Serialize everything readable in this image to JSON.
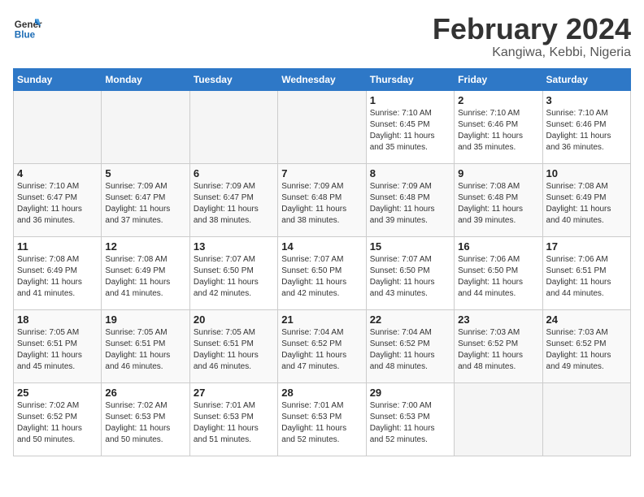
{
  "logo": {
    "line1": "General",
    "line2": "Blue"
  },
  "title": "February 2024",
  "subtitle": "Kangiwa, Kebbi, Nigeria",
  "days_of_week": [
    "Sunday",
    "Monday",
    "Tuesday",
    "Wednesday",
    "Thursday",
    "Friday",
    "Saturday"
  ],
  "weeks": [
    [
      {
        "day": "",
        "info": ""
      },
      {
        "day": "",
        "info": ""
      },
      {
        "day": "",
        "info": ""
      },
      {
        "day": "",
        "info": ""
      },
      {
        "day": "1",
        "info": "Sunrise: 7:10 AM\nSunset: 6:45 PM\nDaylight: 11 hours\nand 35 minutes."
      },
      {
        "day": "2",
        "info": "Sunrise: 7:10 AM\nSunset: 6:46 PM\nDaylight: 11 hours\nand 35 minutes."
      },
      {
        "day": "3",
        "info": "Sunrise: 7:10 AM\nSunset: 6:46 PM\nDaylight: 11 hours\nand 36 minutes."
      }
    ],
    [
      {
        "day": "4",
        "info": "Sunrise: 7:10 AM\nSunset: 6:47 PM\nDaylight: 11 hours\nand 36 minutes."
      },
      {
        "day": "5",
        "info": "Sunrise: 7:09 AM\nSunset: 6:47 PM\nDaylight: 11 hours\nand 37 minutes."
      },
      {
        "day": "6",
        "info": "Sunrise: 7:09 AM\nSunset: 6:47 PM\nDaylight: 11 hours\nand 38 minutes."
      },
      {
        "day": "7",
        "info": "Sunrise: 7:09 AM\nSunset: 6:48 PM\nDaylight: 11 hours\nand 38 minutes."
      },
      {
        "day": "8",
        "info": "Sunrise: 7:09 AM\nSunset: 6:48 PM\nDaylight: 11 hours\nand 39 minutes."
      },
      {
        "day": "9",
        "info": "Sunrise: 7:08 AM\nSunset: 6:48 PM\nDaylight: 11 hours\nand 39 minutes."
      },
      {
        "day": "10",
        "info": "Sunrise: 7:08 AM\nSunset: 6:49 PM\nDaylight: 11 hours\nand 40 minutes."
      }
    ],
    [
      {
        "day": "11",
        "info": "Sunrise: 7:08 AM\nSunset: 6:49 PM\nDaylight: 11 hours\nand 41 minutes."
      },
      {
        "day": "12",
        "info": "Sunrise: 7:08 AM\nSunset: 6:49 PM\nDaylight: 11 hours\nand 41 minutes."
      },
      {
        "day": "13",
        "info": "Sunrise: 7:07 AM\nSunset: 6:50 PM\nDaylight: 11 hours\nand 42 minutes."
      },
      {
        "day": "14",
        "info": "Sunrise: 7:07 AM\nSunset: 6:50 PM\nDaylight: 11 hours\nand 42 minutes."
      },
      {
        "day": "15",
        "info": "Sunrise: 7:07 AM\nSunset: 6:50 PM\nDaylight: 11 hours\nand 43 minutes."
      },
      {
        "day": "16",
        "info": "Sunrise: 7:06 AM\nSunset: 6:50 PM\nDaylight: 11 hours\nand 44 minutes."
      },
      {
        "day": "17",
        "info": "Sunrise: 7:06 AM\nSunset: 6:51 PM\nDaylight: 11 hours\nand 44 minutes."
      }
    ],
    [
      {
        "day": "18",
        "info": "Sunrise: 7:05 AM\nSunset: 6:51 PM\nDaylight: 11 hours\nand 45 minutes."
      },
      {
        "day": "19",
        "info": "Sunrise: 7:05 AM\nSunset: 6:51 PM\nDaylight: 11 hours\nand 46 minutes."
      },
      {
        "day": "20",
        "info": "Sunrise: 7:05 AM\nSunset: 6:51 PM\nDaylight: 11 hours\nand 46 minutes."
      },
      {
        "day": "21",
        "info": "Sunrise: 7:04 AM\nSunset: 6:52 PM\nDaylight: 11 hours\nand 47 minutes."
      },
      {
        "day": "22",
        "info": "Sunrise: 7:04 AM\nSunset: 6:52 PM\nDaylight: 11 hours\nand 48 minutes."
      },
      {
        "day": "23",
        "info": "Sunrise: 7:03 AM\nSunset: 6:52 PM\nDaylight: 11 hours\nand 48 minutes."
      },
      {
        "day": "24",
        "info": "Sunrise: 7:03 AM\nSunset: 6:52 PM\nDaylight: 11 hours\nand 49 minutes."
      }
    ],
    [
      {
        "day": "25",
        "info": "Sunrise: 7:02 AM\nSunset: 6:52 PM\nDaylight: 11 hours\nand 50 minutes."
      },
      {
        "day": "26",
        "info": "Sunrise: 7:02 AM\nSunset: 6:53 PM\nDaylight: 11 hours\nand 50 minutes."
      },
      {
        "day": "27",
        "info": "Sunrise: 7:01 AM\nSunset: 6:53 PM\nDaylight: 11 hours\nand 51 minutes."
      },
      {
        "day": "28",
        "info": "Sunrise: 7:01 AM\nSunset: 6:53 PM\nDaylight: 11 hours\nand 52 minutes."
      },
      {
        "day": "29",
        "info": "Sunrise: 7:00 AM\nSunset: 6:53 PM\nDaylight: 11 hours\nand 52 minutes."
      },
      {
        "day": "",
        "info": ""
      },
      {
        "day": "",
        "info": ""
      }
    ]
  ]
}
